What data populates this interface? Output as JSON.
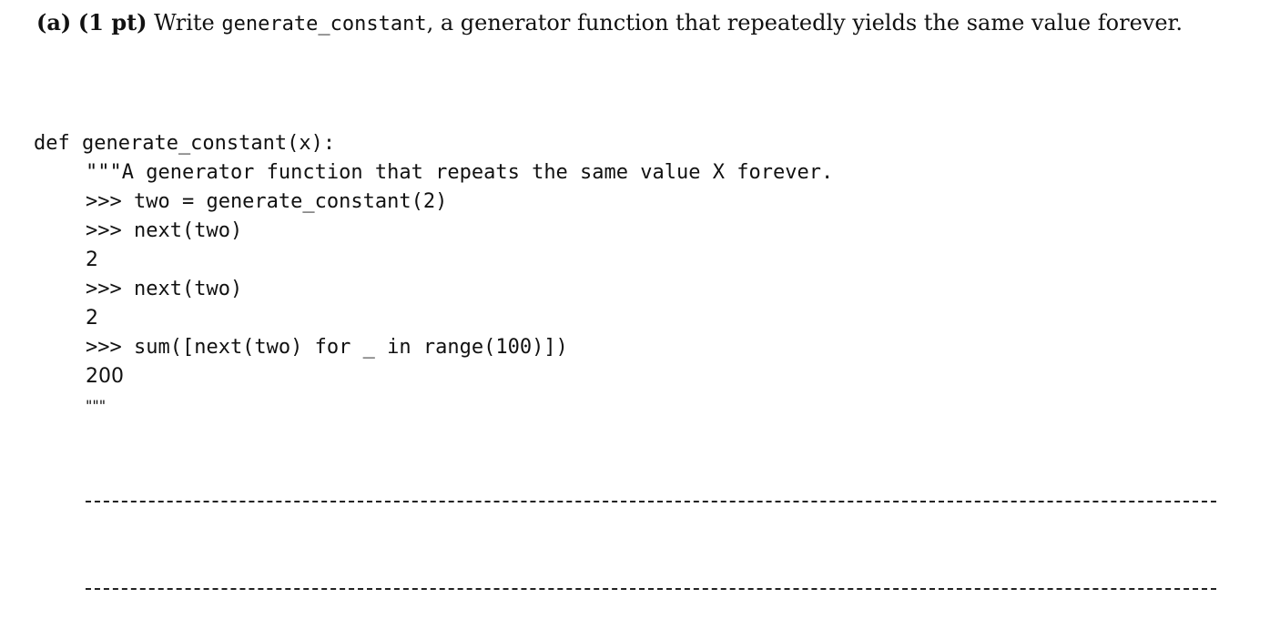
{
  "question": {
    "part": "(a)",
    "points": "(1 pt)",
    "text_before": " Write ",
    "function_name": "generate_constant",
    "text_after": ", a generator function that repeatedly yields the same value forever."
  },
  "code": {
    "signature": "def generate_constant(x):",
    "docstring_open": "\"\"\"A generator function that repeats the same value X forever.",
    "doctest_1": ">>> two = generate_constant(2)",
    "doctest_2": ">>> next(two)",
    "output_1": "2",
    "doctest_3": ">>> next(two)",
    "output_2": "2",
    "doctest_4": ">>> sum([next(two) for _ in range(100)])",
    "output_3": "200",
    "docstring_close": "\"\"\""
  },
  "answer_blanks": 2
}
